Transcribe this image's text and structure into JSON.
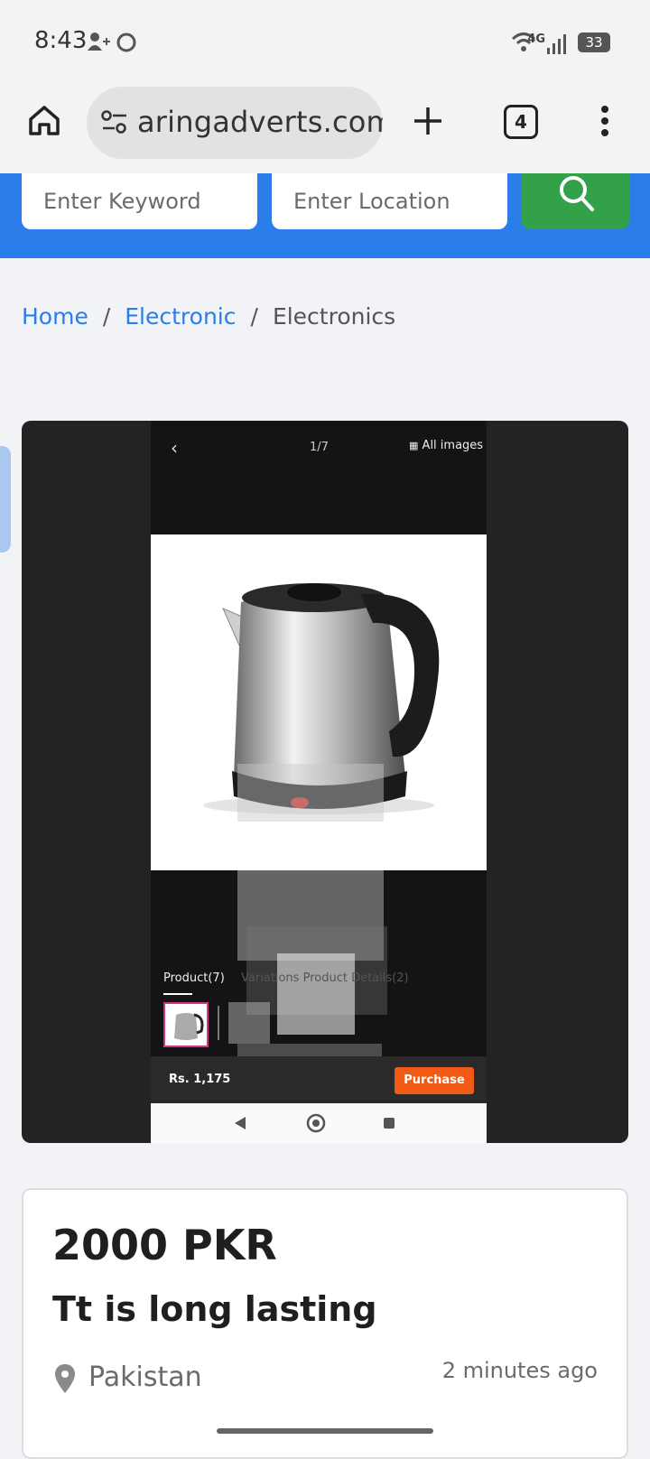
{
  "status_bar": {
    "time": "8:43",
    "network": "4G",
    "battery": "33"
  },
  "browser": {
    "url": "aringadverts.com",
    "tab_count": "4"
  },
  "search": {
    "keyword_placeholder": "Enter Keyword",
    "location_placeholder": "Enter Location"
  },
  "breadcrumb": {
    "home": "Home",
    "category": "Electronic",
    "current": "Electronics",
    "separator": "/"
  },
  "gallery": {
    "back": "‹",
    "counter": "1/7",
    "all_images": "All images",
    "tab_product": "Product(7)",
    "tab_details": "Variations   Product Details(2)",
    "price": "Rs. 1,175",
    "purchase": "Purchase"
  },
  "listing": {
    "price": "2000 PKR",
    "title": "Tt is long lasting",
    "location": "Pakistan",
    "posted": "2 minutes ago"
  },
  "colors": {
    "brand_blue": "#2b7de9",
    "search_green": "#33a04a",
    "purchase_orange": "#f05a14"
  }
}
